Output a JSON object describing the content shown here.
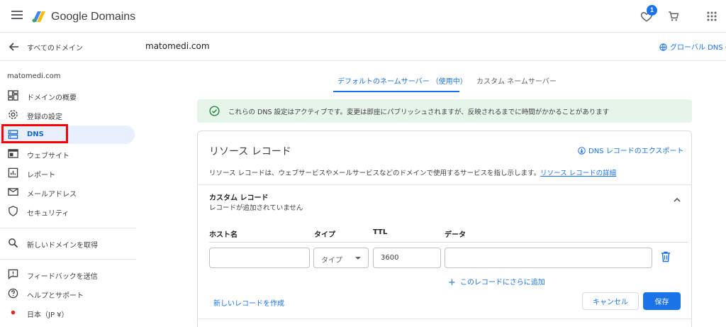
{
  "header": {
    "brand": "Google Domains",
    "badge_count": "1",
    "colors": {
      "accent": "#1a73e8",
      "banner_bg": "#e6f4ea",
      "highlight": "#ff0000"
    }
  },
  "subheader": {
    "back_label": "すべてのドメイン",
    "domain": "matomedi.com",
    "global_dns": "グローバル DNS の"
  },
  "sidebar": {
    "domain": "matomedi.com",
    "items": [
      {
        "label": "ドメインの概要",
        "icon": "dashboard-icon"
      },
      {
        "label": "登録の設定",
        "icon": "gear-icon"
      },
      {
        "label": "DNS",
        "icon": "dns-icon",
        "active": true
      },
      {
        "label": "ウェブサイト",
        "icon": "website-icon"
      },
      {
        "label": "レポート",
        "icon": "report-icon"
      },
      {
        "label": "メールアドレス",
        "icon": "mail-icon"
      },
      {
        "label": "セキュリティ",
        "icon": "shield-icon"
      }
    ],
    "search_item": {
      "label": "新しいドメインを取得",
      "icon": "search-icon"
    },
    "footer_items": [
      {
        "label": "フィードバックを送信",
        "icon": "feedback-icon"
      },
      {
        "label": "ヘルプとサポート",
        "icon": "help-icon"
      },
      {
        "label": "日本（JP ¥）",
        "icon": "red-dot-icon"
      }
    ]
  },
  "main": {
    "tabs": [
      {
        "label": "デフォルトのネームサーバー （使用中）",
        "active": true
      },
      {
        "label": "カスタム ネームサーバー",
        "active": false
      }
    ],
    "banner": "これらの DNS 設定はアクティブです。変更は即座にパブリッシュされますが、反映されるまでに時間がかかることがあります",
    "card": {
      "title": "リソース レコード",
      "export_label": "DNS レコードのエクスポート",
      "description": "リソース レコードは、ウェブサービスやメールサービスなどのドメインで使用するサービスを指し示します。",
      "details_link": "リソース レコードの詳細",
      "section_title": "カスタム レコード",
      "section_sub": "レコードが追加されていません",
      "columns": [
        "ホスト名",
        "タイプ",
        "TTL",
        "データ"
      ],
      "row": {
        "host": "",
        "type": "タイプ",
        "ttl": "3600",
        "data": ""
      },
      "add_more": "このレコードにさらに追加",
      "new_record": "新しいレコードを作成",
      "cancel": "キャンセル",
      "save": "保存"
    }
  }
}
